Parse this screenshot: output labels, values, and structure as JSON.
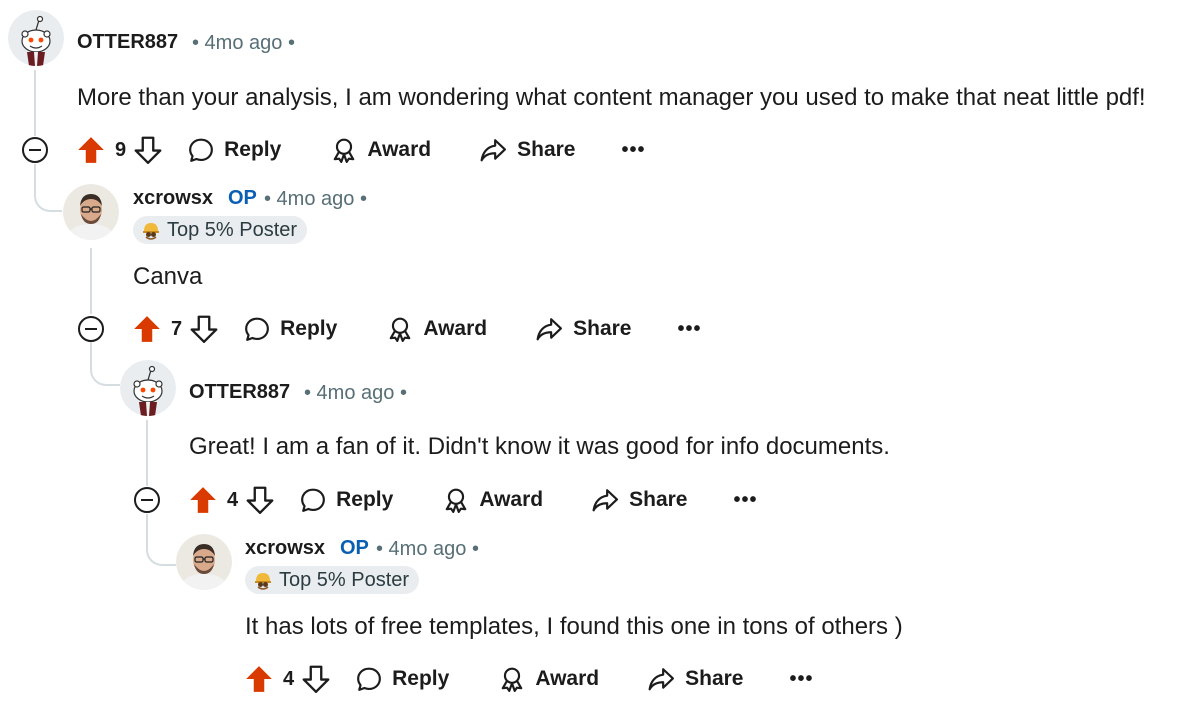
{
  "colors": {
    "upvote": "#d93a00",
    "op": "#0a5fb4",
    "meta": "#576f76",
    "thread": "#d6dde0"
  },
  "actions": {
    "reply": "Reply",
    "award": "Award",
    "share": "Share",
    "more": "•••"
  },
  "comments": [
    {
      "username": "OTTER887",
      "time": "• 4mo ago •",
      "body": "More than your analysis, I am wondering what content manager you used to make that neat little pdf!",
      "votes": "9",
      "avatar": "snoo-avatar-icon"
    },
    {
      "username": "xcrowsx",
      "op": "OP",
      "time": "• 4mo ago •",
      "flair": "Top 5% Poster",
      "body": "Canva",
      "votes": "7",
      "avatar": "user-photo-avatar"
    },
    {
      "username": "OTTER887",
      "time": "• 4mo ago •",
      "body": "Great! I am a fan of it. Didn't know it was good for info documents.",
      "votes": "4",
      "avatar": "snoo-avatar-icon"
    },
    {
      "username": "xcrowsx",
      "op": "OP",
      "time": "• 4mo ago •",
      "flair": "Top 5% Poster",
      "body": "It has lots of free templates, I found this one in tons of others )",
      "votes": "4",
      "avatar": "user-photo-avatar"
    }
  ]
}
